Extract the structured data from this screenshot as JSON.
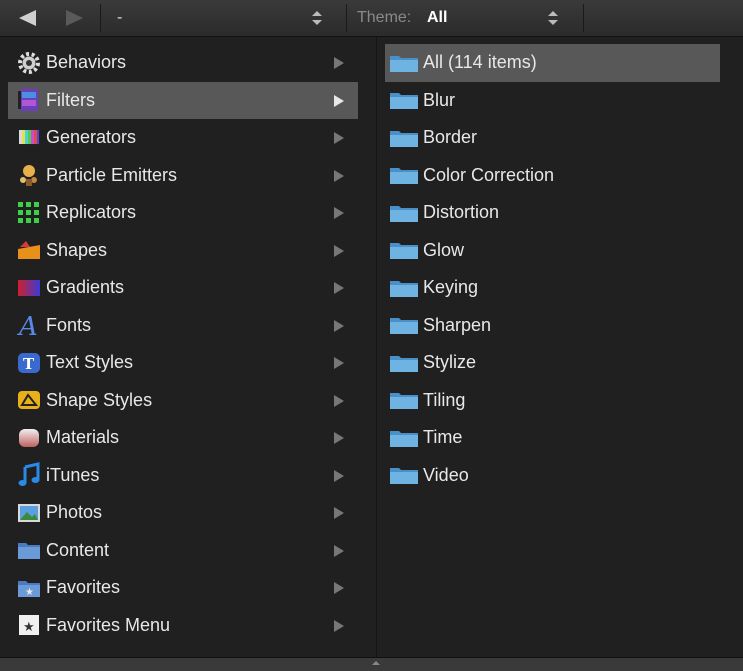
{
  "toolbar": {
    "back_icon": "back-arrow-icon",
    "forward_icon": "forward-arrow-icon",
    "path_value": "-",
    "theme_label": "Theme:",
    "theme_value": "All"
  },
  "categories": [
    {
      "label": "Behaviors",
      "icon": "gear-icon",
      "selected": false
    },
    {
      "label": "Filters",
      "icon": "filters-icon",
      "selected": true
    },
    {
      "label": "Generators",
      "icon": "generators-icon",
      "selected": false
    },
    {
      "label": "Particle Emitters",
      "icon": "particle-emitters-icon",
      "selected": false
    },
    {
      "label": "Replicators",
      "icon": "replicators-icon",
      "selected": false
    },
    {
      "label": "Shapes",
      "icon": "shapes-icon",
      "selected": false
    },
    {
      "label": "Gradients",
      "icon": "gradients-icon",
      "selected": false
    },
    {
      "label": "Fonts",
      "icon": "fonts-icon",
      "selected": false
    },
    {
      "label": "Text Styles",
      "icon": "text-styles-icon",
      "selected": false
    },
    {
      "label": "Shape Styles",
      "icon": "shape-styles-icon",
      "selected": false
    },
    {
      "label": "Materials",
      "icon": "materials-icon",
      "selected": false
    },
    {
      "label": "iTunes",
      "icon": "music-note-icon",
      "selected": false
    },
    {
      "label": "Photos",
      "icon": "photos-icon",
      "selected": false
    },
    {
      "label": "Content",
      "icon": "content-folder-icon",
      "selected": false
    },
    {
      "label": "Favorites",
      "icon": "favorites-folder-icon",
      "selected": false
    },
    {
      "label": "Favorites Menu",
      "icon": "favorites-menu-icon",
      "selected": false
    }
  ],
  "folders": [
    {
      "label": "All (114 items)",
      "selected": true
    },
    {
      "label": "Blur",
      "selected": false
    },
    {
      "label": "Border",
      "selected": false
    },
    {
      "label": "Color Correction",
      "selected": false
    },
    {
      "label": "Distortion",
      "selected": false
    },
    {
      "label": "Glow",
      "selected": false
    },
    {
      "label": "Keying",
      "selected": false
    },
    {
      "label": "Sharpen",
      "selected": false
    },
    {
      "label": "Stylize",
      "selected": false
    },
    {
      "label": "Tiling",
      "selected": false
    },
    {
      "label": "Time",
      "selected": false
    },
    {
      "label": "Video",
      "selected": false
    }
  ],
  "colors": {
    "background": "#202020",
    "selected_row": "#585858",
    "folder_blue": "#6fb3e3"
  }
}
